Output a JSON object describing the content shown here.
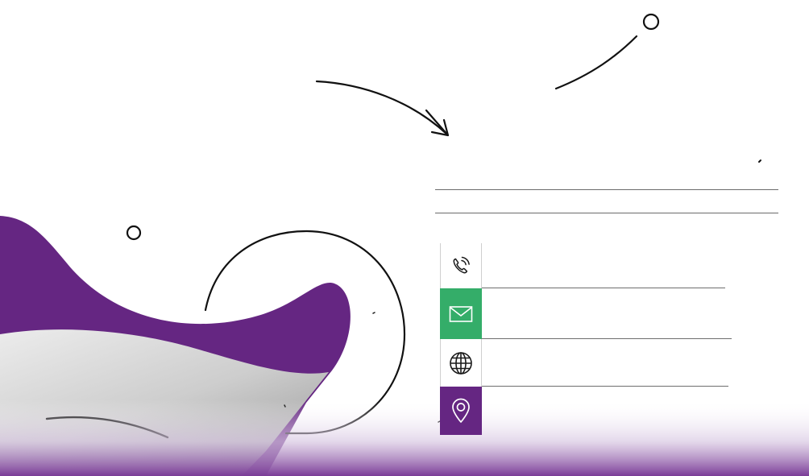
{
  "colors": {
    "brand_purple": "#652682",
    "accent_green": "#34ad69",
    "gray_wave_light": "#e6e6e6",
    "gray_wave_dark": "#b2b2b2",
    "line_color": "#111111"
  },
  "contacts": [
    {
      "icon": "phone-icon",
      "text": "",
      "background": "#ffffff"
    },
    {
      "icon": "mail-icon",
      "text": "",
      "background": "#34ad69"
    },
    {
      "icon": "globe-icon",
      "text": "",
      "background": "#ffffff"
    },
    {
      "icon": "map-pin-icon",
      "text": "",
      "background": "#652682"
    }
  ]
}
